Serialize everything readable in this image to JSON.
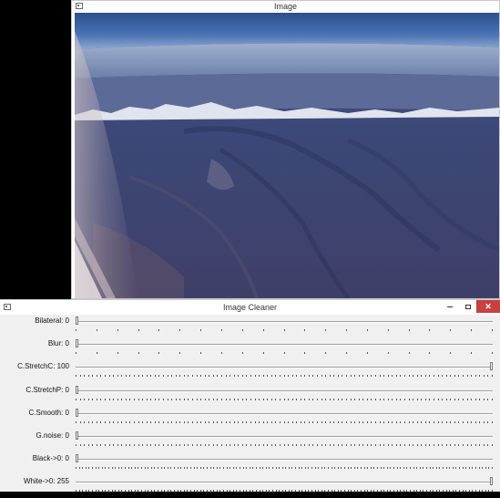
{
  "image_window": {
    "title": "Image"
  },
  "cleaner_window": {
    "title": "Image Cleaner",
    "buttons": {
      "minimize": "minimize",
      "maximize": "maximize",
      "close": "✕"
    },
    "sliders": [
      {
        "id": "bilateral",
        "label": "Bilateral: 0",
        "value": 0,
        "max": 20,
        "tick_count": 21
      },
      {
        "id": "blur",
        "label": "Blur: 0",
        "value": 0,
        "max": 20,
        "tick_count": 21
      },
      {
        "id": "cstretchc",
        "label": "C.StretchC: 100",
        "value": 100,
        "max": 100,
        "tick_count": 101
      },
      {
        "id": "cstretchp",
        "label": "C.StretchP: 0",
        "value": 0,
        "max": 100,
        "tick_count": 101
      },
      {
        "id": "csmooth",
        "label": "C.Smooth: 0",
        "value": 0,
        "max": 100,
        "tick_count": 101
      },
      {
        "id": "gnoise",
        "label": "G.noise: 0",
        "value": 0,
        "max": 100,
        "tick_count": 101
      },
      {
        "id": "black",
        "label": "Black->0: 0",
        "value": 0,
        "max": 255,
        "tick_count": 128
      },
      {
        "id": "white",
        "label": "White->0: 255",
        "value": 255,
        "max": 255,
        "tick_count": 128
      }
    ]
  },
  "colors": {
    "close_button": "#c84040",
    "window_bg": "#f0f0f0",
    "desktop": "#000000"
  }
}
